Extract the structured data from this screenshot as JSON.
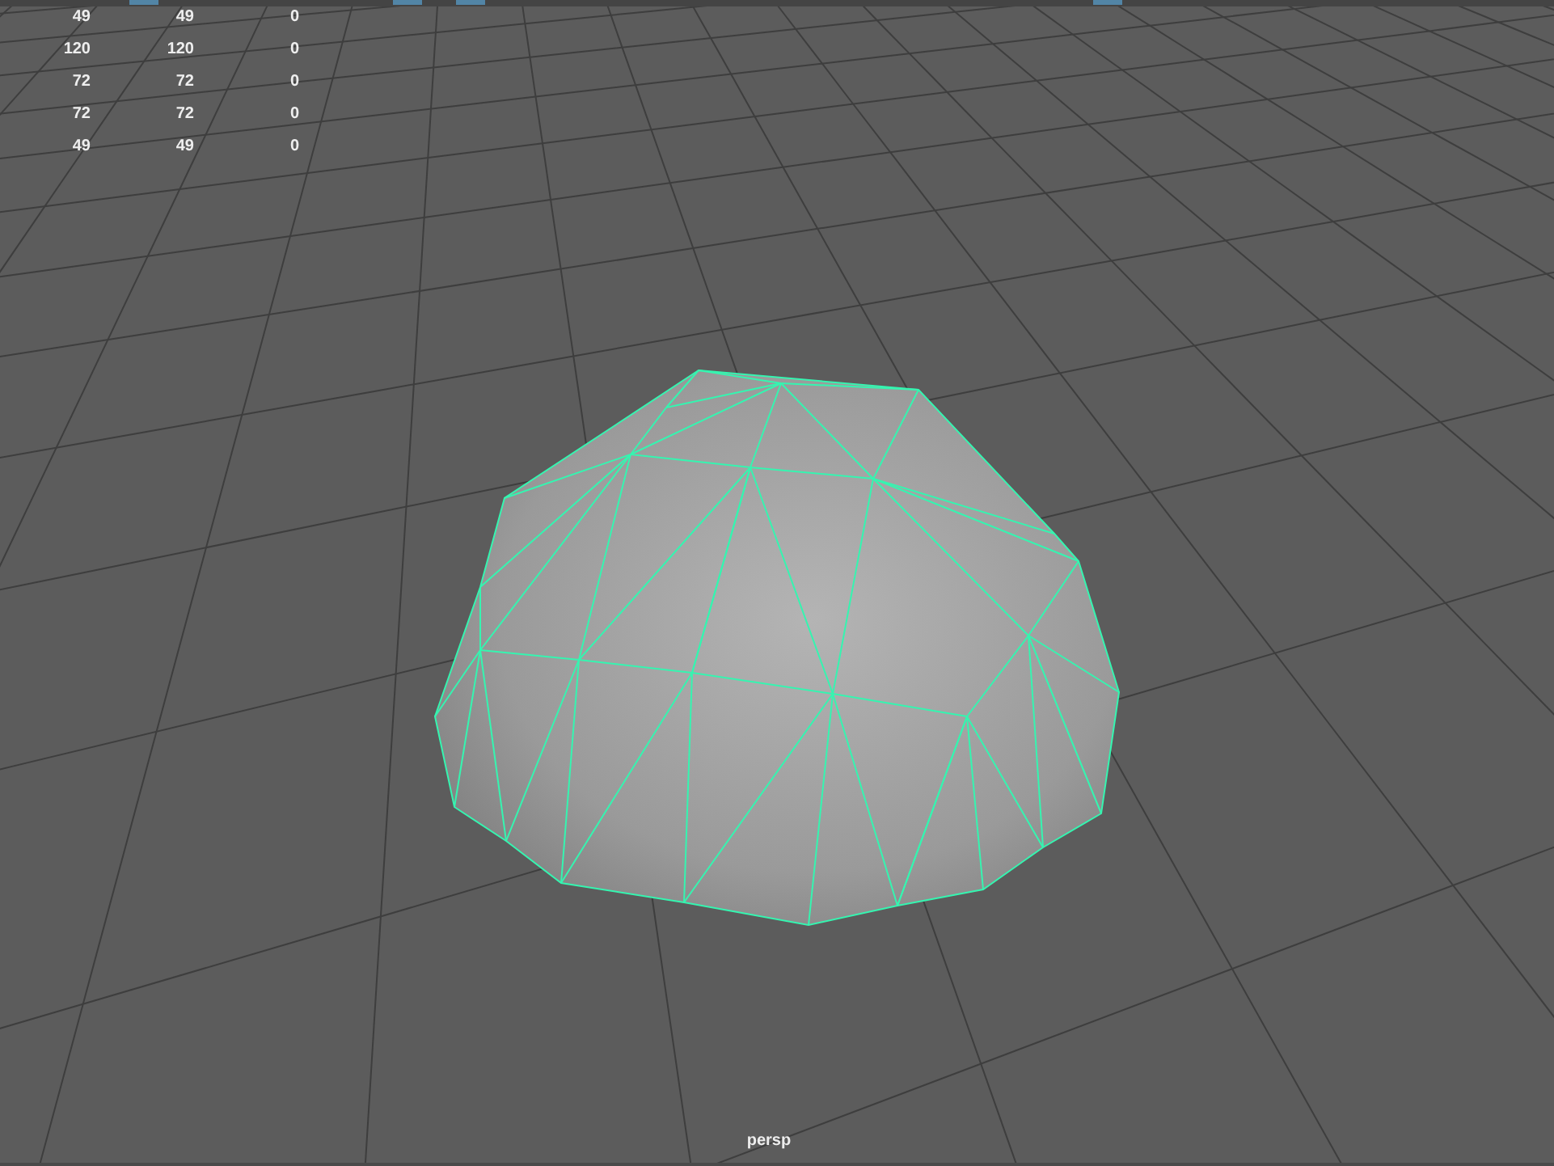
{
  "hud_stats": {
    "rows": [
      [
        "49",
        "49",
        "0"
      ],
      [
        "120",
        "120",
        "0"
      ],
      [
        "72",
        "72",
        "0"
      ],
      [
        "72",
        "72",
        "0"
      ],
      [
        "49",
        "49",
        "0"
      ]
    ]
  },
  "viewport": {
    "camera_label": "persp"
  }
}
